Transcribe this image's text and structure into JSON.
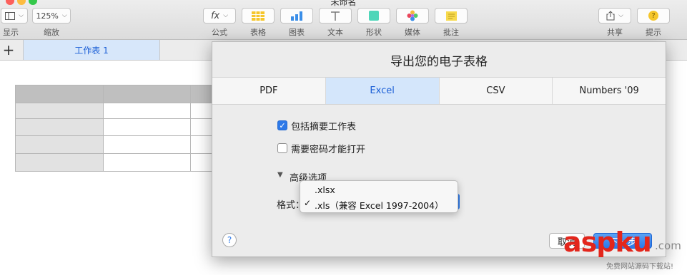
{
  "window": {
    "title": "未命名"
  },
  "toolbar": {
    "view_label": "显示",
    "zoom_value": "125%",
    "zoom_label": "缩放",
    "formula_symbol": "fx",
    "formula_label": "公式",
    "table_label": "表格",
    "chart_label": "图表",
    "text_label": "文本",
    "shape_label": "形状",
    "media_label": "媒体",
    "comment_label": "批注",
    "share_label": "共享",
    "tips_label": "提示"
  },
  "sheet_tabs": {
    "add_symbol": "+",
    "active_tab": "工作表 1"
  },
  "dialog": {
    "title": "导出您的电子表格",
    "tabs": [
      {
        "label": "PDF"
      },
      {
        "label": "Excel"
      },
      {
        "label": "CSV"
      },
      {
        "label": "Numbers '09"
      }
    ],
    "active_tab": "Excel",
    "include_summary_label": "包括摘要工作表",
    "include_summary_checked": true,
    "require_password_label": "需要密码才能打开",
    "require_password_checked": false,
    "advanced_label": "高级选项",
    "format_label": "格式：",
    "help_symbol": "?",
    "cancel_label": "取消",
    "next_label": "下一步"
  },
  "format_menu": {
    "items": [
      {
        "label": ".xlsx",
        "checked": false
      },
      {
        "label": ".xls（兼容 Excel 1997-2004）",
        "checked": true
      }
    ]
  },
  "watermark": {
    "text": "aspku",
    "domain": ".com",
    "caption": "免费网站源码下载站!"
  },
  "colors": {
    "accent": "#2d79e8",
    "tab_active_bg": "#d4e6fb",
    "header_fill": "#bfbfbf",
    "watermark_red": "#e3261c"
  }
}
